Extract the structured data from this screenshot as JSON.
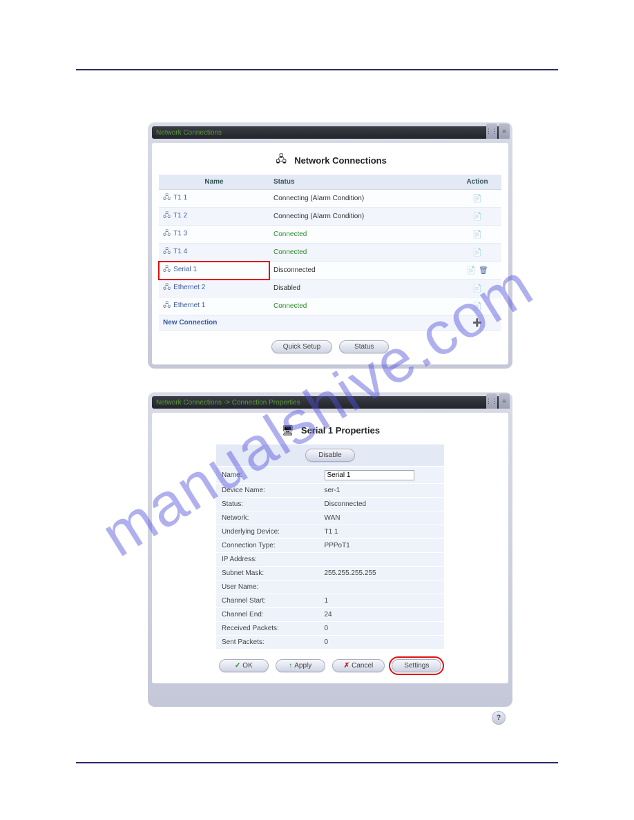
{
  "watermark": "manualshive.com",
  "window1": {
    "titlebar": "Network Connections",
    "heading": "Network Connections",
    "columns": {
      "name": "Name",
      "status": "Status",
      "action": "Action"
    },
    "rows": [
      {
        "name": "T1 1",
        "status": "Connecting (Alarm Condition)",
        "status_class": "connecting",
        "highlight": false,
        "actions": 1
      },
      {
        "name": "T1 2",
        "status": "Connecting (Alarm Condition)",
        "status_class": "connecting",
        "highlight": false,
        "actions": 1
      },
      {
        "name": "T1 3",
        "status": "Connected",
        "status_class": "connected",
        "highlight": false,
        "actions": 1
      },
      {
        "name": "T1 4",
        "status": "Connected",
        "status_class": "connected",
        "highlight": false,
        "actions": 1
      },
      {
        "name": "Serial 1",
        "status": "Disconnected",
        "status_class": "disconnected",
        "highlight": true,
        "actions": 2
      },
      {
        "name": "Ethernet 2",
        "status": "Disabled",
        "status_class": "disconnected",
        "highlight": false,
        "actions": 1
      },
      {
        "name": "Ethernet 1",
        "status": "Connected",
        "status_class": "connected",
        "highlight": false,
        "actions": 1
      }
    ],
    "new_connection": "New Connection",
    "buttons": {
      "quick_setup": "Quick Setup",
      "status": "Status"
    }
  },
  "window2": {
    "titlebar": "Network Connections -> Connection Properties",
    "heading": "Serial 1 Properties",
    "disable_btn": "Disable",
    "name_input": "Serial 1",
    "props": [
      {
        "label": "Name:",
        "value": ""
      },
      {
        "label": "Device Name:",
        "value": "ser-1"
      },
      {
        "label": "Status:",
        "value": "Disconnected"
      },
      {
        "label": "Network:",
        "value": "WAN"
      },
      {
        "label": "Underlying Device:",
        "value": "T1 1"
      },
      {
        "label": "Connection Type:",
        "value": "PPPoT1"
      },
      {
        "label": "IP Address:",
        "value": ""
      },
      {
        "label": "Subnet Mask:",
        "value": "255.255.255.255"
      },
      {
        "label": "User Name:",
        "value": ""
      },
      {
        "label": "Channel Start:",
        "value": "1"
      },
      {
        "label": "Channel End:",
        "value": "24"
      },
      {
        "label": "Received Packets:",
        "value": "0"
      },
      {
        "label": "Sent Packets:",
        "value": "0"
      }
    ],
    "buttons": {
      "ok": "OK",
      "apply": "Apply",
      "cancel": "Cancel",
      "settings": "Settings"
    },
    "help": "?"
  }
}
